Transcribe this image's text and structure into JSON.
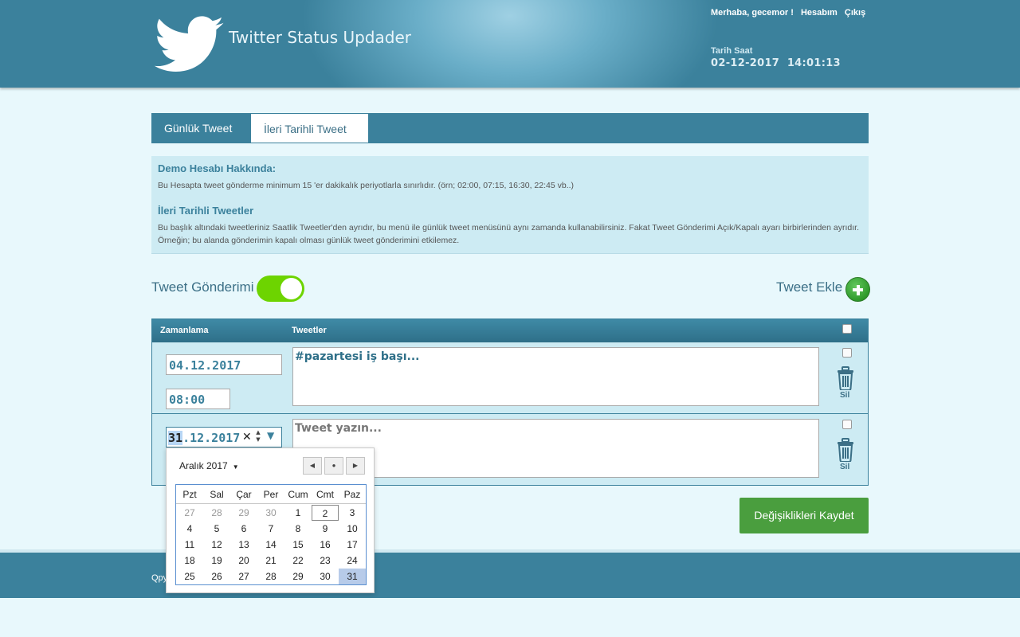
{
  "header": {
    "app_title": "Twitter Status Updader",
    "greeting": "Merhaba, gecemor !",
    "account_link": "Hesabım",
    "logout_link": "Çıkış",
    "datetime_label": "Tarih Saat",
    "date": "02-12-2017",
    "time": "14:01:13"
  },
  "tabs": [
    {
      "label": "Günlük Tweet",
      "active": true
    },
    {
      "label": "İleri Tarihli Tweet",
      "active": false
    }
  ],
  "info": {
    "demo_title": "Demo Hesabı Hakkında:",
    "demo_text": "Bu Hesapta tweet gönderme minimum 15 'er dakikalık periyotlarla sınırlıdır. (örn; 02:00, 07:15, 16:30, 22:45 vb..)",
    "future_title": "İleri Tarihli Tweetler",
    "future_text": "Bu başlık altındaki tweetleriniz Saatlik Tweetler'den ayrıdır, bu menü ile günlük tweet menüsünü aynı zamanda kullanabilirsiniz. Fakat Tweet Gönderimi Açık/Kapalı ayarı birbirlerinden ayrıdır. Örneğin; bu alanda gönderimin kapalı olması günlük tweet gönderimini etkilemez."
  },
  "controls": {
    "toggle_label": "Tweet Gönderimi",
    "toggle_on": true,
    "add_label": "Tweet Ekle"
  },
  "table": {
    "col_schedule": "Zamanlama",
    "col_tweets": "Tweetler",
    "delete_label": "Sil",
    "rows": [
      {
        "date": "04.12.2017",
        "time": "08:00",
        "tweet": "#pazartesi iş başı..."
      },
      {
        "date_day": "31",
        "date_rest": ".12.2017",
        "tweet_placeholder": "Tweet yazın..."
      }
    ]
  },
  "save_button": "Değişiklikleri Kaydet",
  "footer": {
    "text": "Qpy"
  },
  "calendar": {
    "month_label": "Aralık 2017",
    "weekdays": [
      "Pzt",
      "Sal",
      "Çar",
      "Per",
      "Cum",
      "Cmt",
      "Paz"
    ],
    "weeks": [
      [
        "27",
        "28",
        "29",
        "30",
        "1",
        "2",
        "3"
      ],
      [
        "4",
        "5",
        "6",
        "7",
        "8",
        "9",
        "10"
      ],
      [
        "11",
        "12",
        "13",
        "14",
        "15",
        "16",
        "17"
      ],
      [
        "18",
        "19",
        "20",
        "21",
        "22",
        "23",
        "24"
      ],
      [
        "25",
        "26",
        "27",
        "28",
        "29",
        "30",
        "31"
      ]
    ],
    "today": "2",
    "selected": "31"
  },
  "colors": {
    "primary": "#3b819c",
    "toggle_on": "#6dd400",
    "save_green": "#4a9e3e",
    "add_green": "#2f9a2b"
  }
}
